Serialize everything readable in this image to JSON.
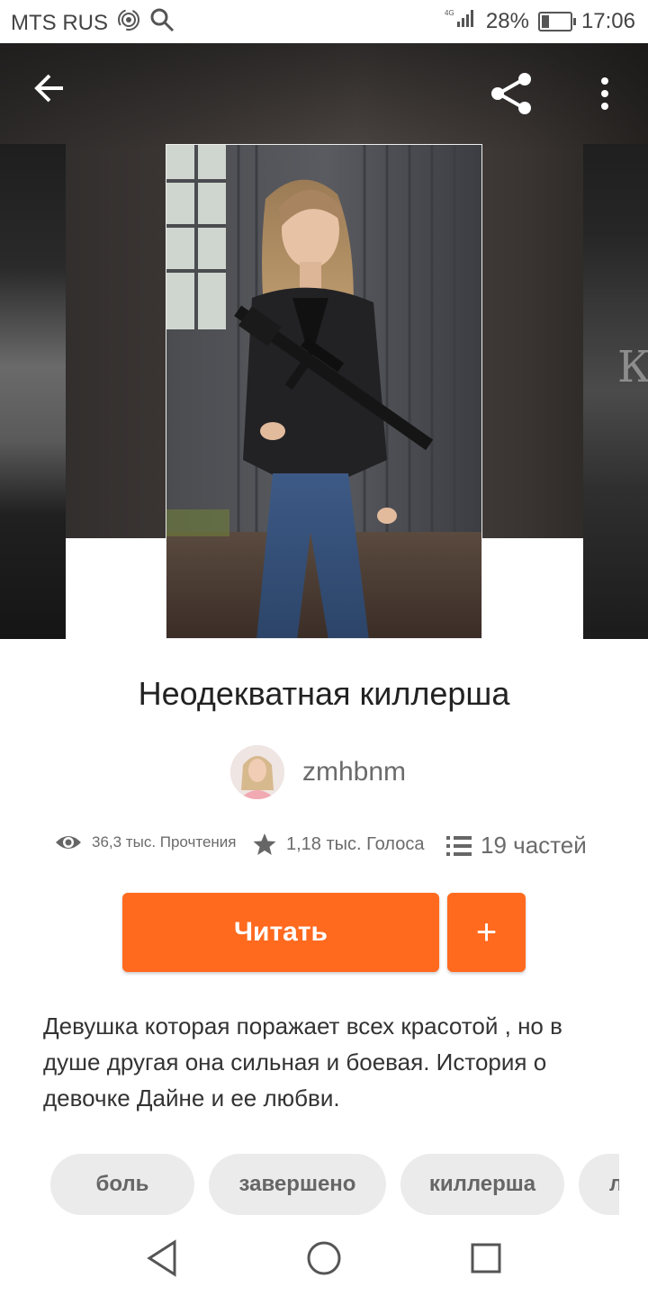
{
  "status": {
    "carrier": "MTS RUS",
    "network": "4G",
    "battery": "28%",
    "battery_level": 0.28,
    "time": "17:06"
  },
  "header": {
    "back_icon": "arrow-left-icon",
    "share_icon": "share-icon",
    "menu_icon": "more-vertical-icon"
  },
  "story": {
    "title": "Неодекватная киллерша",
    "author": "zmhbnm",
    "stats": {
      "reads": "36,3 тыс. Прочтения",
      "votes": "1,18 тыс. Голоса",
      "parts": "19 частей"
    },
    "read_button": "Читать",
    "add_button": "+",
    "description": "Девушка которая поражает всех красотой , но в душе другая она сильная и боевая. История о девочке Дайне и ее любви.",
    "tags": [
      "боль",
      "завершено",
      "киллерша",
      "л"
    ]
  },
  "side_cover_right_letter": "К",
  "colors": {
    "accent": "#ff6a1f",
    "tag_bg": "#ebebeb",
    "text": "#222222"
  }
}
